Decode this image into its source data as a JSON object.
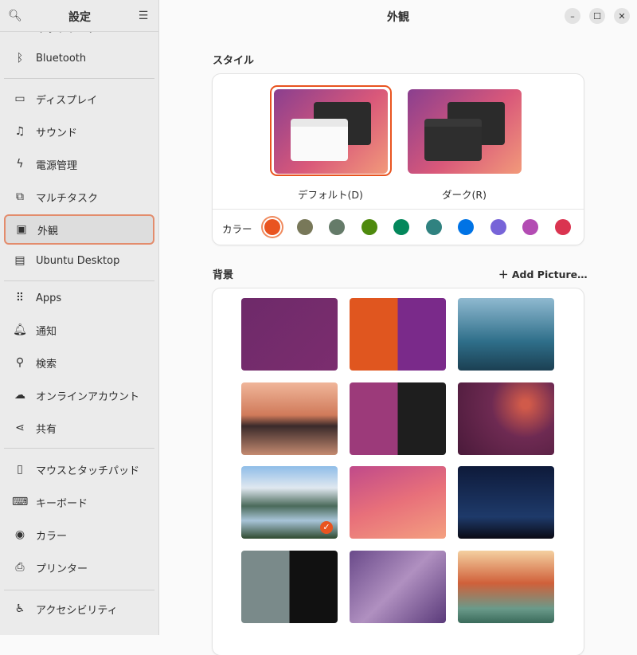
{
  "sidebar": {
    "title": "設定",
    "search_icon": "search-icon",
    "menu_icon": "hamburger-menu-icon",
    "items": [
      {
        "label": "ネットワーク",
        "icon": "network-icon"
      },
      {
        "label": "Bluetooth",
        "icon": "bluetooth-icon"
      },
      {
        "label": "ディスプレイ",
        "icon": "display-icon"
      },
      {
        "label": "サウンド",
        "icon": "music-note-icon"
      },
      {
        "label": "電源管理",
        "icon": "power-icon"
      },
      {
        "label": "マルチタスク",
        "icon": "multitasking-icon"
      },
      {
        "label": "外観",
        "icon": "appearance-icon",
        "selected": true
      },
      {
        "label": "Ubuntu Desktop",
        "icon": "ubuntu-desktop-icon"
      },
      {
        "label": "Apps",
        "icon": "apps-grid-icon"
      },
      {
        "label": "通知",
        "icon": "bell-icon"
      },
      {
        "label": "検索",
        "icon": "search-icon"
      },
      {
        "label": "オンラインアカウント",
        "icon": "cloud-icon"
      },
      {
        "label": "共有",
        "icon": "share-icon"
      },
      {
        "label": "マウスとタッチパッド",
        "icon": "mouse-icon"
      },
      {
        "label": "キーボード",
        "icon": "keyboard-icon"
      },
      {
        "label": "カラー",
        "icon": "color-icon"
      },
      {
        "label": "プリンター",
        "icon": "printer-icon"
      },
      {
        "label": "アクセシビリティ",
        "icon": "accessibility-icon"
      }
    ]
  },
  "header": {
    "title": "外観"
  },
  "style": {
    "title": "スタイル",
    "themes": [
      {
        "label": "デフォルト(D)",
        "selected": true
      },
      {
        "label": "ダーク(R)",
        "selected": false
      }
    ],
    "color_label": "カラー",
    "accent_colors": [
      "#e95420",
      "#787859",
      "#657b69",
      "#4e8a0e",
      "#03875b",
      "#308280",
      "#0073e5",
      "#7764d8",
      "#b34cb3",
      "#da3450"
    ],
    "selected_color": "#e95420"
  },
  "background": {
    "title": "背景",
    "add_picture": "Add Picture…",
    "selected_index": 6,
    "wallpapers": [
      "purple-bull",
      "orange-purple-bull",
      "lake-reflection",
      "mount-fuji",
      "purple-dark-split",
      "dark-orbit",
      "mountain-lake",
      "pink-tiger",
      "milky-way",
      "minotaur",
      "purple-beast",
      "desert-canyon"
    ]
  }
}
